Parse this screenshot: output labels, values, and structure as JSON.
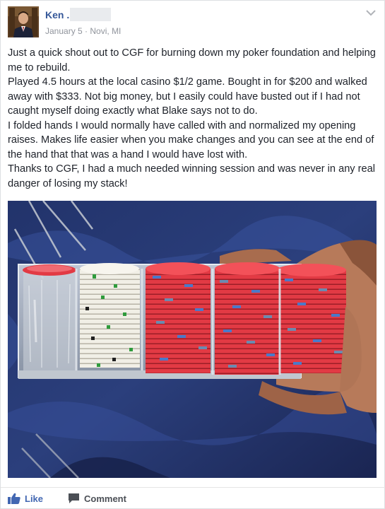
{
  "post": {
    "author_name": "Ken .",
    "date": "January 5",
    "separator": "·",
    "location": "Novi, MI",
    "paragraphs": [
      "Just a quick shout out to CGF for burning down my poker foundation and helping me to rebuild.",
      "Played 4.5 hours at the local casino $1/2 game. Bought in for $200 and walked away with $333. Not big money, but I easily could have busted out if I had not caught myself doing exactly what Blake says not to do.",
      "I folded hands I would normally have called with and normalized my opening raises. Makes life easier when you make changes and you can see at the end of the hand that that was a hand I would have lost with.",
      "Thanks to CGF, I had a much needed winning session and was never in any real danger of losing my stack!"
    ]
  },
  "actions": {
    "like_label": "Like",
    "comment_label": "Comment"
  },
  "icons": {
    "options": "chevron-down-icon",
    "like": "thumbs-up-icon",
    "comment": "speech-bubble-icon"
  },
  "colors": {
    "author_link": "#365899",
    "like_blue": "#4267b2",
    "meta_gray": "#90949c",
    "chip_red": "#e23a44",
    "chip_white": "#f1efe6",
    "chip_blue": "#4a79c9"
  }
}
